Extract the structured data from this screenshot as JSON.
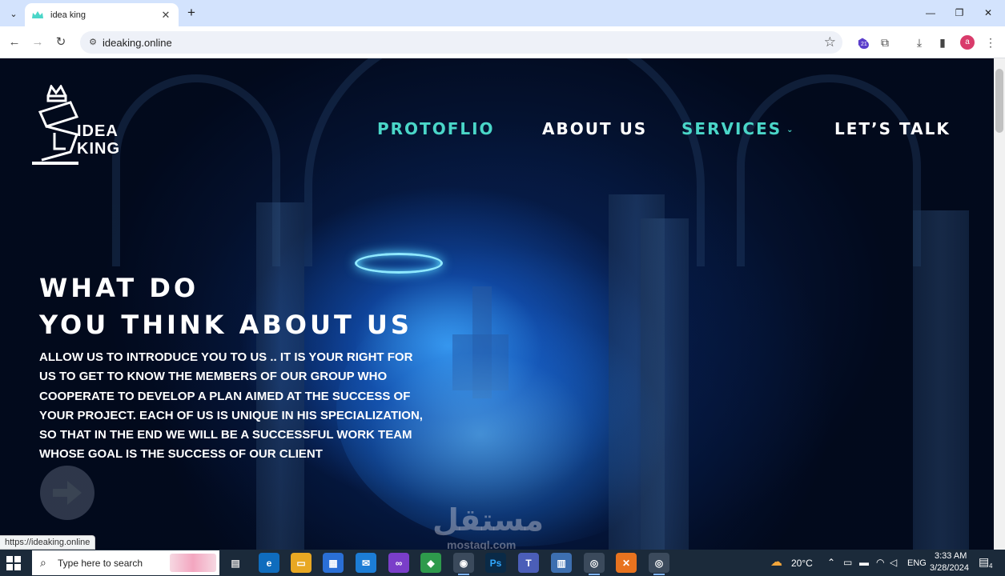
{
  "browser": {
    "tab_title": "idea king",
    "url": "ideaking.online",
    "status_url": "https://ideaking.online",
    "extension_badge": "21",
    "profile_initial": "a"
  },
  "site": {
    "logo_lines": [
      "IDEA",
      "KING"
    ],
    "nav": [
      {
        "label": "PROTOFLIO",
        "color": "#4ad6c8"
      },
      {
        "label": "ABOUT US",
        "color": "#ffffff"
      },
      {
        "label": "SERVICES",
        "color": "#4ad6c8"
      },
      {
        "label": "LET’S TALK",
        "color": "#ffffff"
      }
    ],
    "hero": {
      "title_line1": "WHAT DO",
      "title_line2": "YOU THINK ABOUT US",
      "text_lines": [
        "ALLOW US TO INTRODUCE YOU TO US .. IT IS YOUR RIGHT FOR",
        "US TO GET TO KNOW THE MEMBERS OF OUR GROUP WHO",
        "COOPERATE TO DEVELOP A PLAN AIMED AT THE SUCCESS OF",
        "YOUR PROJECT. EACH OF US IS UNIQUE IN HIS SPECIALIZATION,",
        "SO THAT IN THE END WE WILL BE A SUCCESSFUL WORK TEAM",
        "WHOSE GOAL IS THE SUCCESS OF OUR CLIENT"
      ]
    },
    "watermark": "مستقل",
    "watermark_sub": "mostaql.com"
  },
  "taskbar": {
    "search_placeholder": "Type here to search",
    "temperature": "20°C",
    "language": "ENG",
    "time": "3:33 AM",
    "date": "3/28/2024",
    "notification_count": "4"
  }
}
